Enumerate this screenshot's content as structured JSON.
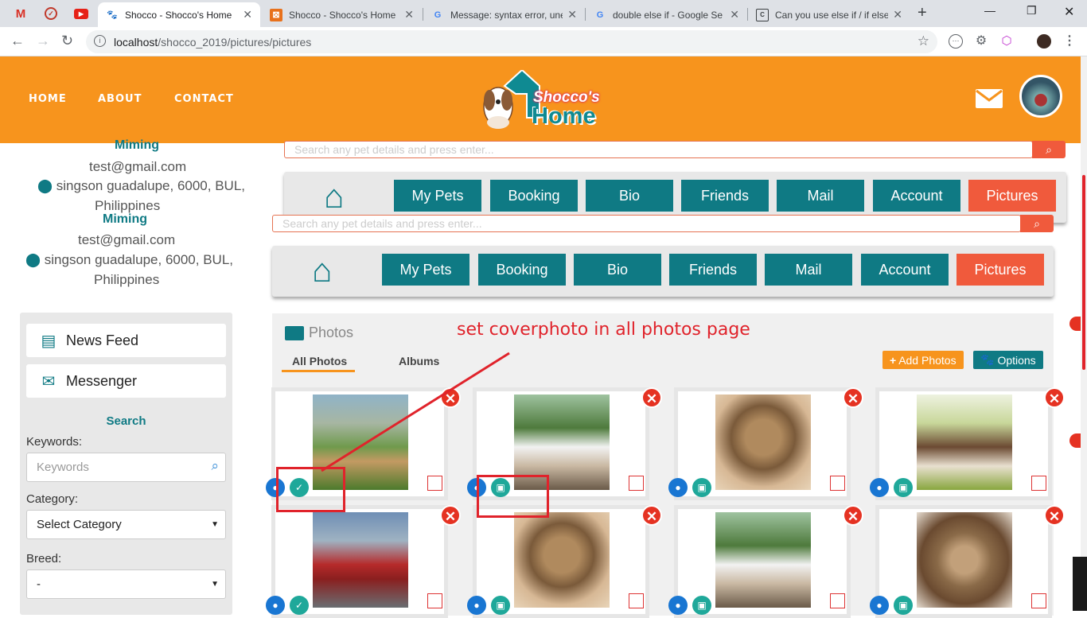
{
  "browser": {
    "tabs": [
      {
        "title": "Shocco - Shocco's Home",
        "active": true
      },
      {
        "title": "Shocco - Shocco's Home",
        "active": false
      },
      {
        "title": "Message: syntax error, une",
        "active": false
      },
      {
        "title": "double else if - Google Se",
        "active": false
      },
      {
        "title": "Can you use else if / if else",
        "active": false
      }
    ],
    "url_host": "localhost",
    "url_path": "/shocco_2019/pictures/pictures"
  },
  "header": {
    "nav": [
      "HOME",
      "ABOUT",
      "CONTACT"
    ],
    "logo_line1": "Shocco's",
    "logo_line2": "Home"
  },
  "profile": {
    "name": "Miming",
    "email": "test@gmail.com",
    "address_line1": "singson guadalupe, 6000, BUL,",
    "address_line2": "Philippines"
  },
  "sidebar": {
    "news_feed": "News Feed",
    "messenger": "Messenger",
    "search_heading": "Search",
    "keywords_label": "Keywords:",
    "keywords_placeholder": "Keywords",
    "category_label": "Category:",
    "category_value": "Select Category",
    "breed_label": "Breed:",
    "breed_value": "-"
  },
  "search": {
    "placeholder": "Search any pet details and press enter..."
  },
  "menu": [
    "My Pets",
    "Booking",
    "Bio",
    "Friends",
    "Mail",
    "Account",
    "Pictures"
  ],
  "menu_active": "Pictures",
  "photos": {
    "title": "Photos",
    "tabs": [
      "All Photos",
      "Albums"
    ],
    "active_tab": "All Photos",
    "add_label": "Add Photos",
    "options_label": "Options",
    "items": [
      {
        "subject": "dogs-playing",
        "cover": true
      },
      {
        "subject": "shih-tzu",
        "cover": false
      },
      {
        "subject": "tabby-cat",
        "cover": false
      },
      {
        "subject": "puppies",
        "cover": false
      },
      {
        "subject": "red-car",
        "cover": true
      },
      {
        "subject": "tabby-cat",
        "cover": false
      },
      {
        "subject": "shih-tzu",
        "cover": false
      },
      {
        "subject": "tabby-cat-closeup",
        "cover": false
      }
    ]
  },
  "annotation": {
    "text": "set coverphoto in all photos page"
  },
  "colors": {
    "header_orange": "#f7941d",
    "teal": "#0f7a84",
    "accent_red": "#f05a3c",
    "annotation_red": "#e0232b"
  }
}
